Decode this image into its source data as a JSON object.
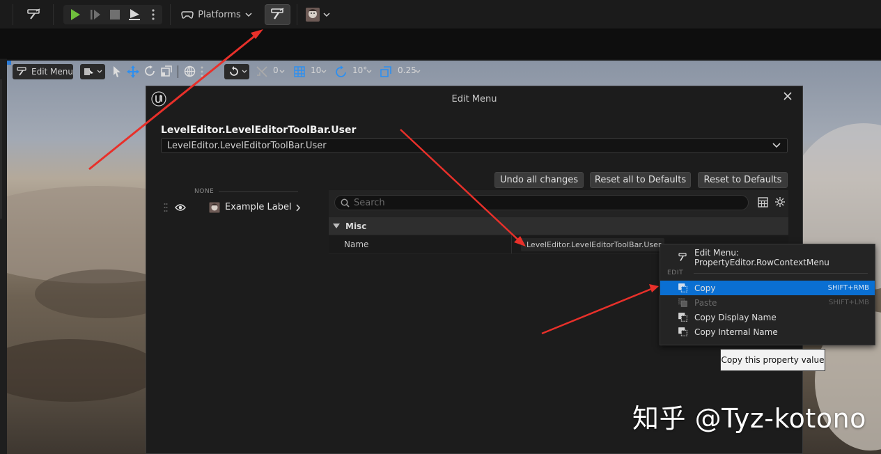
{
  "toolbar": {
    "platforms_label": "Platforms",
    "icons": [
      "settings-brush-icon",
      "play-icon",
      "step-icon",
      "stop-icon",
      "eject-icon",
      "more-icon",
      "controller-icon",
      "chevron-down-icon",
      "toolbar-settings-icon",
      "avatar-icon"
    ]
  },
  "viewport_toolbar": {
    "edit_menu_label": "Edit Menu",
    "surface_snap": "0",
    "grid_snap": "10",
    "rotation_snap": "10°",
    "scale_snap": "0.25"
  },
  "dialog": {
    "title": "Edit Menu",
    "heading": "LevelEditor.LevelEditorToolBar.User",
    "menu_selector_value": "LevelEditor.LevelEditorToolBar.User",
    "buttons": {
      "undo_all": "Undo all changes",
      "reset_all_defaults": "Reset all to Defaults",
      "reset_defaults": "Reset to Defaults"
    },
    "section_label": "NONE",
    "entry_label": "Example Label",
    "search_placeholder": "Search",
    "category": "Misc",
    "property_name": "Name",
    "property_value": "LevelEditor.LevelEditorToolBar.User"
  },
  "context_menu": {
    "header_item": "Edit Menu: PropertyEditor.RowContextMenu",
    "section": "EDIT",
    "items": [
      {
        "label": "Copy",
        "shortcut": "SHIFT+RMB",
        "state": "highlighted"
      },
      {
        "label": "Paste",
        "shortcut": "SHIFT+LMB",
        "state": "disabled"
      },
      {
        "label": "Copy Display Name",
        "shortcut": "",
        "state": "normal"
      },
      {
        "label": "Copy Internal Name",
        "shortcut": "",
        "state": "normal"
      }
    ]
  },
  "tooltip": "Copy this property value",
  "watermark": "知乎 @Tyz-kotono",
  "colors": {
    "accent_blue": "#0a6fd2",
    "arrow_red": "#e8302a",
    "play_green": "#6fbf3c",
    "panel_bg": "#1c1c1c"
  }
}
